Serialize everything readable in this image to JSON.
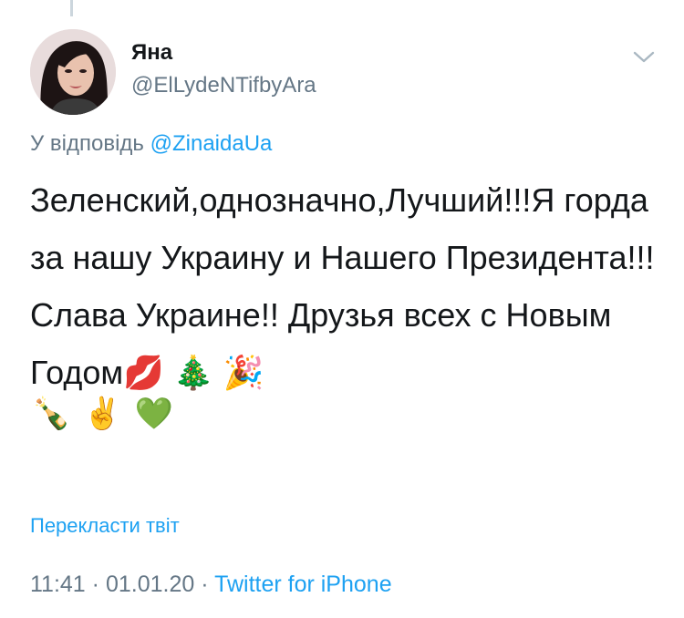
{
  "tweet": {
    "author": {
      "display_name": "Яна",
      "handle": "@ElLydeNTifbyAra"
    },
    "reply_prefix": "У відповідь ",
    "reply_to": "@ZinaidaUa",
    "text": "Зеленский,однозначно,Лучший!!!Я горда за нашу Украину и Нашего Президента!!!Слава Украине!! Друзья всех с Новым Годом💋 🎄 🎉",
    "emojis": [
      "🍾",
      "✌️",
      "💚"
    ],
    "translate_label": "Перекласти твіт",
    "time": "11:41",
    "date": "01.01.20",
    "separator": "·",
    "source": "Twitter for iPhone"
  },
  "colors": {
    "accent": "#1da1f2",
    "secondary_text": "#657786",
    "primary_text": "#14171a"
  },
  "icons": {
    "menu": "chevron-down-icon",
    "avatar": "profile-photo"
  }
}
